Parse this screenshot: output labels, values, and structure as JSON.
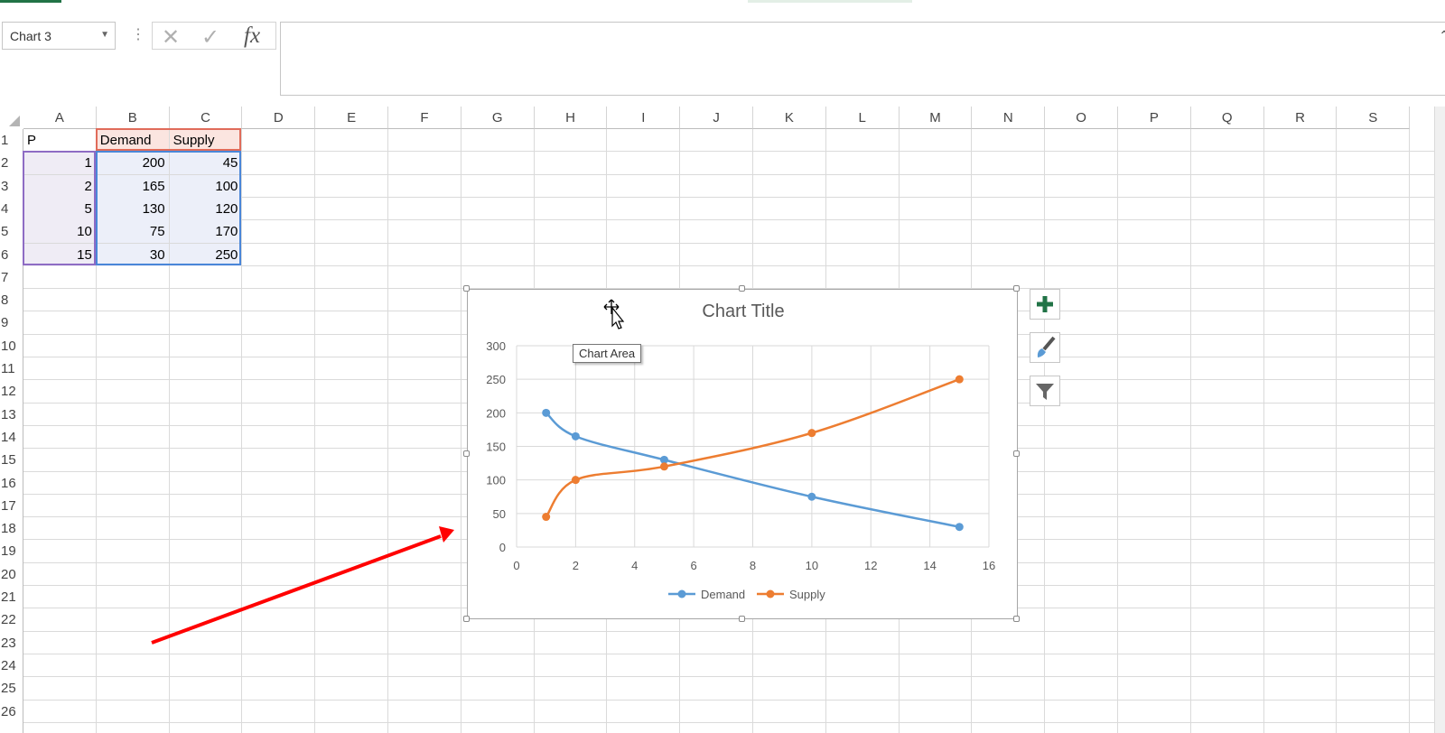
{
  "name_box": "Chart 3",
  "formula_bar": {
    "fx_label": "fx",
    "value": ""
  },
  "columns": [
    "A",
    "B",
    "C",
    "D",
    "E",
    "F",
    "G",
    "H",
    "I",
    "J",
    "K",
    "L",
    "M",
    "N",
    "O",
    "P",
    "Q",
    "R",
    "S"
  ],
  "rows": [
    "1",
    "2",
    "3",
    "4",
    "5",
    "6",
    "7",
    "8",
    "9",
    "10",
    "11",
    "12",
    "13",
    "14",
    "15",
    "16",
    "17",
    "18",
    "19",
    "20",
    "21",
    "22",
    "23",
    "24",
    "25",
    "26"
  ],
  "cells": {
    "A1": "P",
    "B1": "Demand",
    "C1": "Supply",
    "A2": "1",
    "B2": "200",
    "C2": "45",
    "A3": "2",
    "B3": "165",
    "C3": "100",
    "A4": "5",
    "B4": "130",
    "C4": "120",
    "A5": "10",
    "B5": "75",
    "C5": "170",
    "A6": "15",
    "B6": "30",
    "C6": "250"
  },
  "tooltip": "Chart Area",
  "colors": {
    "demand": "#5b9bd5",
    "supply": "#ed7d31",
    "arrow": "#ff0000",
    "accent": "#217346"
  },
  "icons": [
    "cross-icon",
    "check-icon",
    "fx-icon",
    "plus-icon",
    "brush-icon",
    "filter-icon",
    "move-cursor-icon"
  ],
  "chart_data": {
    "type": "scatter",
    "title": "Chart Title",
    "xlim": [
      0,
      16
    ],
    "ylim": [
      0,
      300
    ],
    "xticks": [
      "0",
      "2",
      "4",
      "6",
      "8",
      "10",
      "12",
      "14",
      "16"
    ],
    "yticks": [
      "0",
      "50",
      "100",
      "150",
      "200",
      "250",
      "300"
    ],
    "grid": true,
    "legend_position": "bottom",
    "series": [
      {
        "name": "Demand",
        "x": [
          1,
          2,
          5,
          10,
          15
        ],
        "y": [
          200,
          165,
          130,
          75,
          30
        ]
      },
      {
        "name": "Supply",
        "x": [
          1,
          2,
          5,
          10,
          15
        ],
        "y": [
          45,
          100,
          120,
          170,
          250
        ]
      }
    ]
  }
}
